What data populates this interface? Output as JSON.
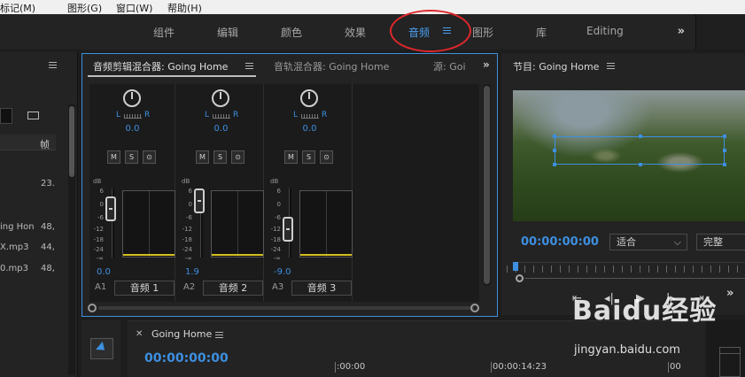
{
  "menu": {
    "items": [
      {
        "label": "标记(M)"
      },
      {
        "label": "图形(G)"
      },
      {
        "label": "窗口(W)"
      },
      {
        "label": "帮助(H)"
      }
    ]
  },
  "workspaces": {
    "tabs": [
      {
        "label": "组件"
      },
      {
        "label": "编辑"
      },
      {
        "label": "颜色"
      },
      {
        "label": "效果"
      },
      {
        "label": "音频",
        "active": true
      },
      {
        "label": "图形"
      },
      {
        "label": "库"
      },
      {
        "label": "Editing"
      }
    ],
    "overflow": "»",
    "highlight_color": "#e0272b"
  },
  "project_panel": {
    "col_header": "帧",
    "rows": [
      {
        "name": "",
        "rate": "23."
      },
      {
        "name": "ing Hon",
        "rate": "48,"
      },
      {
        "name": "X.mp3",
        "rate": "44,"
      },
      {
        "name": "0.mp3",
        "rate": "48,"
      }
    ]
  },
  "mixer": {
    "tabs": [
      {
        "label": "音频剪辑混合器: Going Home",
        "active": true
      },
      {
        "label": "音轨混合器: Going Home"
      },
      {
        "label": "源: Goi"
      }
    ],
    "overflow": "»",
    "lr_left": "L",
    "lr_right": "R",
    "db_label": "dB",
    "scale": [
      "6",
      "0",
      "-6",
      "-12",
      "-18",
      "-24",
      "-∞"
    ],
    "buttons": {
      "mute": "M",
      "solo": "S",
      "record": "⊙"
    },
    "channels": [
      {
        "id": "A1",
        "name": "音频 1",
        "pan": "0.0",
        "volume": "0.0"
      },
      {
        "id": "A2",
        "name": "音频 2",
        "pan": "0.0",
        "volume": "1.9"
      },
      {
        "id": "A3",
        "name": "音频 3",
        "pan": "0.0",
        "volume": "-9.0"
      }
    ]
  },
  "program": {
    "title": "节目: Going Home",
    "timecode": "00:00:00:00",
    "fit": "适合",
    "quality": "完整"
  },
  "timeline": {
    "title": "Going Home",
    "timecode": "00:00:00:00",
    "marks": [
      ":00:00",
      "00:00:14:23",
      "00"
    ]
  },
  "watermark": {
    "logo": "Baidu经验",
    "url": "jingyan.baidu.com"
  },
  "colors": {
    "accent": "#3d8fe0",
    "meter": "#d6c020"
  }
}
